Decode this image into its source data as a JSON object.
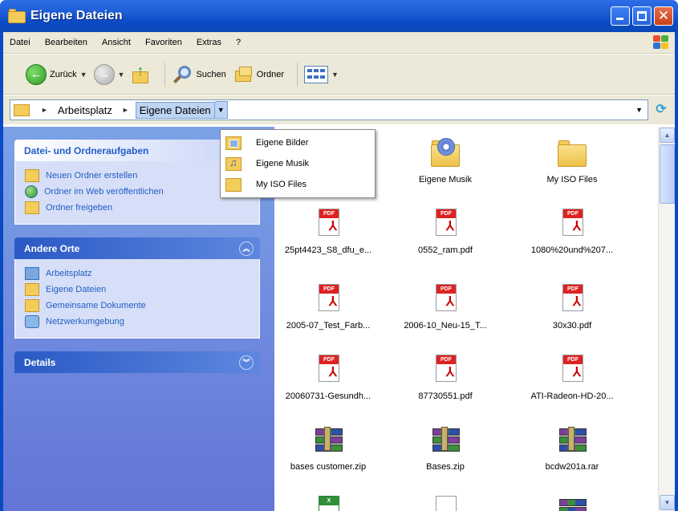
{
  "window": {
    "title": "Eigene Dateien"
  },
  "menubar": {
    "items": [
      "Datei",
      "Bearbeiten",
      "Ansicht",
      "Favoriten",
      "Extras",
      "?"
    ]
  },
  "toolbar": {
    "back_label": "Zurück",
    "search_label": "Suchen",
    "folders_label": "Ordner"
  },
  "address": {
    "root": "Arbeitsplatz",
    "current": "Eigene Dateien"
  },
  "dropdown": {
    "items": [
      "Eigene Bilder",
      "Eigene Musik",
      "My ISO Files"
    ]
  },
  "taskpane": {
    "file_tasks": {
      "title": "Datei- und Ordneraufgaben",
      "items": [
        "Neuen Ordner erstellen",
        "Ordner im Web veröffentlichen",
        "Ordner freigeben"
      ]
    },
    "other_places": {
      "title": "Andere Orte",
      "items": [
        "Arbeitsplatz",
        "Eigene Dateien",
        "Gemeinsame Dokumente",
        "Netzwerkumgebung"
      ]
    },
    "details": {
      "title": "Details"
    }
  },
  "files": [
    {
      "name": "Eigene Musik",
      "type": "music-folder"
    },
    {
      "name": "My ISO Files",
      "type": "folder"
    },
    {
      "name": "25pt4423_S8_dfu_e...",
      "type": "pdf"
    },
    {
      "name": "0552_ram.pdf",
      "type": "pdf"
    },
    {
      "name": "1080%20und%207...",
      "type": "pdf"
    },
    {
      "name": "2005-07_Test_Farb...",
      "type": "pdf"
    },
    {
      "name": "2006-10_Neu-15_T...",
      "type": "pdf"
    },
    {
      "name": "30x30.pdf",
      "type": "pdf"
    },
    {
      "name": "20060731-Gesundh...",
      "type": "pdf"
    },
    {
      "name": "87730551.pdf",
      "type": "pdf"
    },
    {
      "name": "ATI-Radeon-HD-20...",
      "type": "pdf"
    },
    {
      "name": "bases customer.zip",
      "type": "zip"
    },
    {
      "name": "Bases.zip",
      "type": "zip"
    },
    {
      "name": "bcdw201a.rar",
      "type": "zip"
    }
  ],
  "colors": {
    "titlebar": "#0a4ac4",
    "taskpane": "#7ba2e7",
    "link": "#215dc6"
  }
}
